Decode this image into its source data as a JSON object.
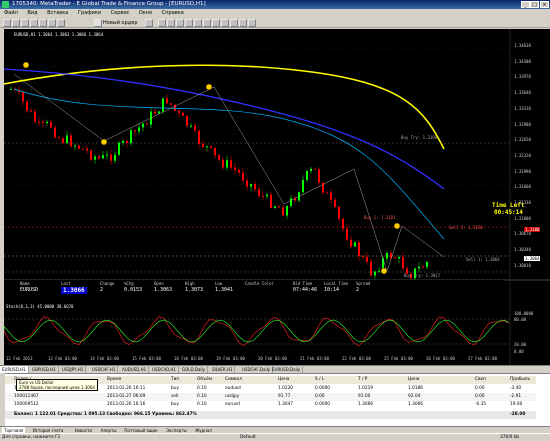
{
  "window": {
    "title": "1705340: MetaTrader - E Global Trade & Finance Group - [EURUSD,H1]",
    "controls": [
      "_",
      "□",
      "×"
    ]
  },
  "menu": [
    "Файл",
    "Вид",
    "Вставка",
    "Графики",
    "Сервис",
    "Окно",
    "Справка"
  ],
  "toolbar": {
    "new_order": "Новый ордер"
  },
  "chart": {
    "header": "EURUSD,H1 1.3064 1.3063 1.3066 1.3064",
    "price_labels": [
      "1.34630",
      "1.34300",
      "1.33970",
      "1.33640",
      "1.33310",
      "1.32980",
      "1.32650",
      "1.32320",
      "1.31990",
      "1.31660",
      "1.31330",
      "1.31000",
      "1.30670",
      "1.30340",
      "1.30010"
    ],
    "price_tags": {
      "red": "1.3100",
      "current": "1.3064"
    },
    "fib_labels": [
      "Buy Try: 1.3198",
      "Sell 2: 1.3150",
      "Buy 1: 1.3101",
      "Sell 1: 1.3064",
      "Buy Try: 1.3017"
    ],
    "time_left_label": "Time Left",
    "time_left": "00:45:14",
    "indicator_header": "Stoch(8,3,3) 45.0000 38.6670",
    "indicator_labels": [
      "100.0000",
      "80.00",
      "20.00",
      "0.00"
    ],
    "time_labels": [
      "12 Feb 2013",
      "13 Feb 03:00",
      "14 Feb 03:00",
      "15 Feb 03:00",
      "18 Feb 03:00",
      "19 Feb 03:00",
      "20 Feb 03:00",
      "21 Feb 03:00",
      "22 Feb 03:00",
      "25 Feb 03:00",
      "26 Feb 03:00",
      "27 Feb 02:00"
    ]
  },
  "infobar": {
    "headers": [
      "Name",
      "Last",
      "Change",
      "%Chg",
      "Open",
      "High",
      "Low",
      "Candle Color",
      "Bid Time",
      "Local Time",
      "Spread"
    ],
    "values": [
      "EURUSD",
      "1.3066",
      "2",
      "0.0153",
      "1.3063",
      "1.3073",
      "1.3041",
      "",
      "07:44:46",
      "10:14",
      "2"
    ]
  },
  "symbol_tabs": [
    "EURUSD,H1",
    "GBPUSD,H1",
    "USDJPY,H1",
    "USDCHF,H1",
    "AUDUSD,H1",
    "USDCAD,H1",
    "GOLD,Daily",
    "SILVER,H1",
    "USDCHF,Daily",
    "EURUSD,Daily"
  ],
  "terminal": {
    "columns": [
      "Ордер /",
      "Время",
      "Тип",
      "Объём",
      "Символ",
      "Цена",
      "S / L",
      "T / P",
      "Цена",
      "Своп",
      "Прибыль"
    ],
    "rows": [
      {
        "order": "100007453",
        "time": "2013.02.26 16:11",
        "type": "buy",
        "volume": "0.10",
        "symbol": "audusd",
        "price": "1.0220",
        "sl": "0.0000",
        "tp": "1.0219",
        "cur": "1.0186",
        "swap": "0.00",
        "profit": "-3.40"
      },
      {
        "order": "100011467",
        "time": "2013.02.27 06:09",
        "type": "sell",
        "volume": "0.10",
        "symbol": "usdjpy",
        "price": "91.77",
        "sl": "0.00",
        "tp": "91.00",
        "cur": "92.04",
        "swap": "0.00",
        "profit": "-2.91"
      },
      {
        "order": "100009512",
        "time": "2013.02.26 16:16",
        "type": "buy",
        "volume": "0.10",
        "symbol": "eurusd",
        "price": "1.3047",
        "sl": "0.0000",
        "tp": "1.3066",
        "cur": "1.3066",
        "swap": "-0.35",
        "profit": "19.00"
      }
    ],
    "balance": "Баланс: 1 122.01  Средства: 1 095.13  Свободно: 966.15  Уровень: 862.47%",
    "balance_total": "-28.00",
    "tooltip_line1": "Euro vs US Dollar",
    "tooltip_line2": "2788 баров, последний цена 1.3064"
  },
  "bottom_tabs": [
    "Торговля",
    "История счета",
    "Новости",
    "Алерты",
    "Почтовый ящик",
    "Эксперты",
    "Журнал"
  ],
  "status": {
    "help": "Для справки, нажмите F1",
    "profile": "Default",
    "conn": "376/0 kb"
  },
  "colors": {
    "bull": "#00ff00",
    "bear": "#ff0000",
    "ma_slow": "#ffff00",
    "ma_mid": "#3030ff",
    "ma_fast": "#00b0ff",
    "time_left": "#ffff00"
  }
}
